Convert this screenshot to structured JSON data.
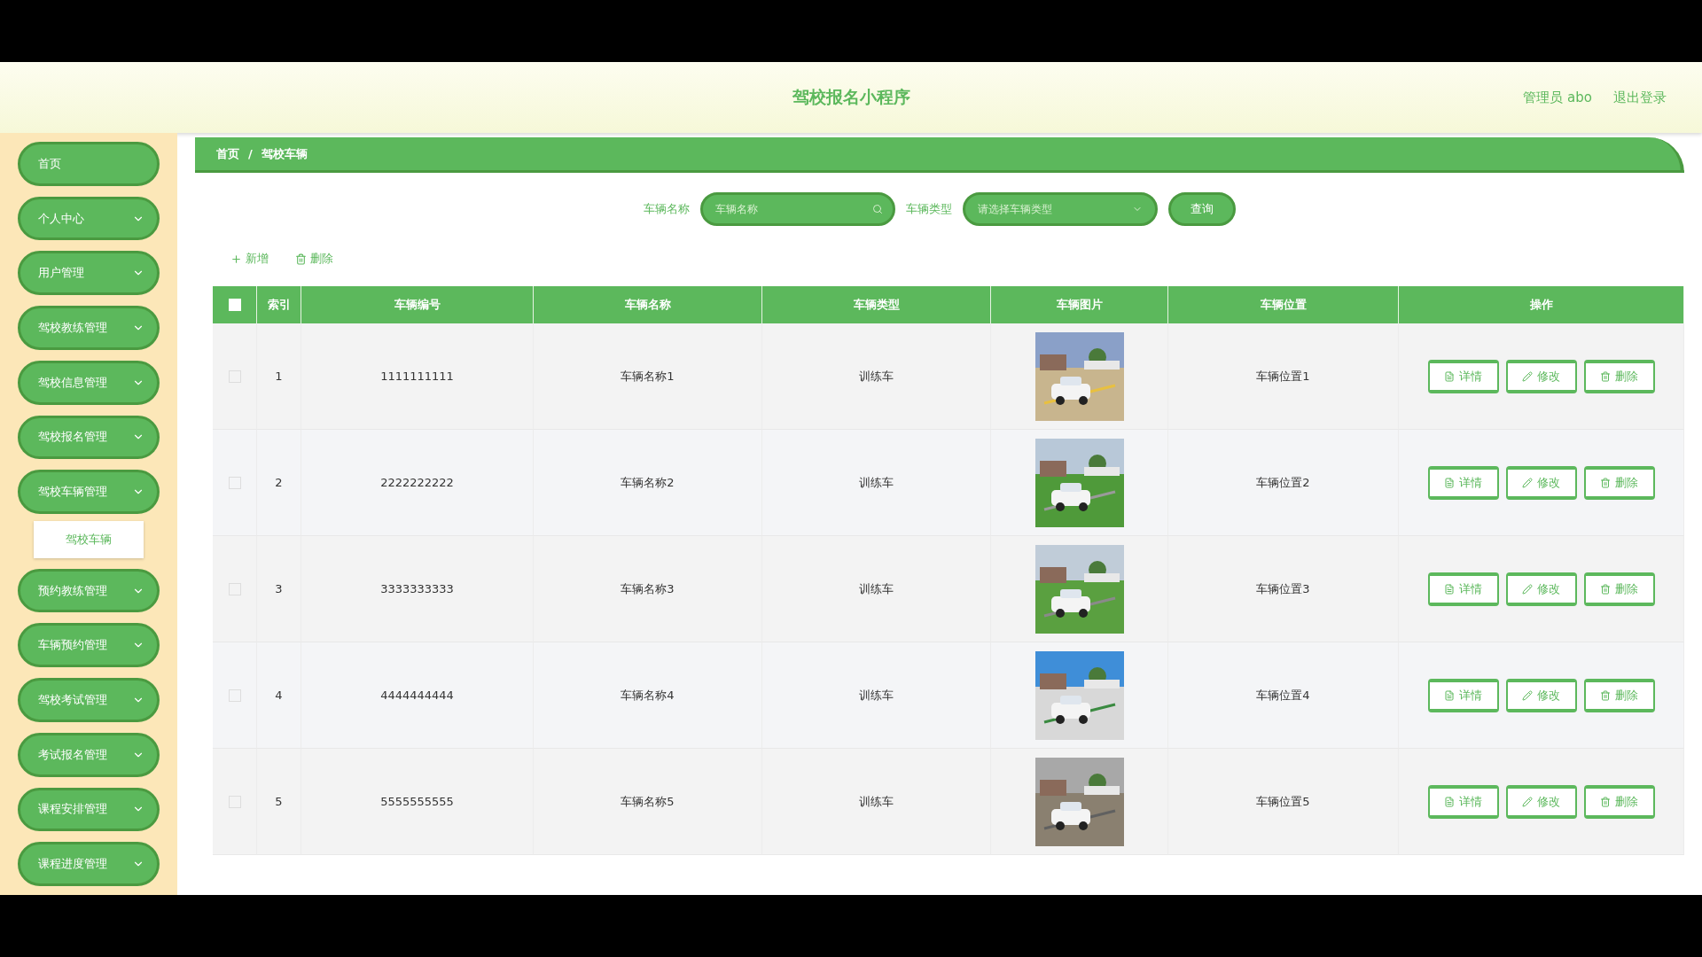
{
  "header": {
    "title": "驾校报名小程序",
    "user": "管理员 abo",
    "logout": "退出登录"
  },
  "sidebar": {
    "items": [
      {
        "label": "首页",
        "kind": "link"
      },
      {
        "label": "个人中心",
        "kind": "menu"
      },
      {
        "label": "用户管理",
        "kind": "menu"
      },
      {
        "label": "驾校教练管理",
        "kind": "menu"
      },
      {
        "label": "驾校信息管理",
        "kind": "menu"
      },
      {
        "label": "驾校报名管理",
        "kind": "menu"
      },
      {
        "label": "驾校车辆管理",
        "kind": "menu",
        "children": [
          {
            "label": "驾校车辆",
            "selected": true
          }
        ]
      },
      {
        "label": "预约教练管理",
        "kind": "menu"
      },
      {
        "label": "车辆预约管理",
        "kind": "menu"
      },
      {
        "label": "驾校考试管理",
        "kind": "menu"
      },
      {
        "label": "考试报名管理",
        "kind": "menu"
      },
      {
        "label": "课程安排管理",
        "kind": "menu"
      },
      {
        "label": "课程进度管理",
        "kind": "menu"
      }
    ]
  },
  "breadcrumb": {
    "items": [
      "首页",
      "驾校车辆"
    ],
    "separator": "/"
  },
  "search": {
    "fields": [
      {
        "label": "车辆名称",
        "kind": "input",
        "placeholder": "车辆名称"
      },
      {
        "label": "车辆类型",
        "kind": "select",
        "placeholder": "请选择车辆类型"
      }
    ],
    "button": "查询"
  },
  "toolbar": [
    {
      "label": "新增",
      "kind": "add"
    },
    {
      "label": "删除",
      "kind": "delete"
    }
  ],
  "table": {
    "select_all_checked": false,
    "columns": [
      "索引",
      "车辆编号",
      "车辆名称",
      "车辆类型",
      "车辆图片",
      "车辆位置",
      "操作"
    ],
    "rows": [
      {
        "checked": false,
        "index": "1",
        "number": "1111111111",
        "name": "车辆名称1",
        "type": "训练车",
        "location": "车辆位置1",
        "actions": [
          "详情",
          "修改",
          "删除"
        ]
      },
      {
        "checked": false,
        "index": "2",
        "number": "2222222222",
        "name": "车辆名称2",
        "type": "训练车",
        "location": "车辆位置2",
        "actions": [
          "详情",
          "修改",
          "删除"
        ]
      },
      {
        "checked": false,
        "index": "3",
        "number": "3333333333",
        "name": "车辆名称3",
        "type": "训练车",
        "location": "车辆位置3",
        "actions": [
          "详情",
          "修改",
          "删除"
        ]
      },
      {
        "checked": false,
        "index": "4",
        "number": "4444444444",
        "name": "车辆名称4",
        "type": "训练车",
        "location": "车辆位置4",
        "actions": [
          "详情",
          "修改",
          "删除"
        ]
      },
      {
        "checked": false,
        "index": "5",
        "number": "5555555555",
        "name": "车辆名称5",
        "type": "训练车",
        "location": "车辆位置5",
        "actions": [
          "详情",
          "修改",
          "删除"
        ]
      }
    ]
  }
}
